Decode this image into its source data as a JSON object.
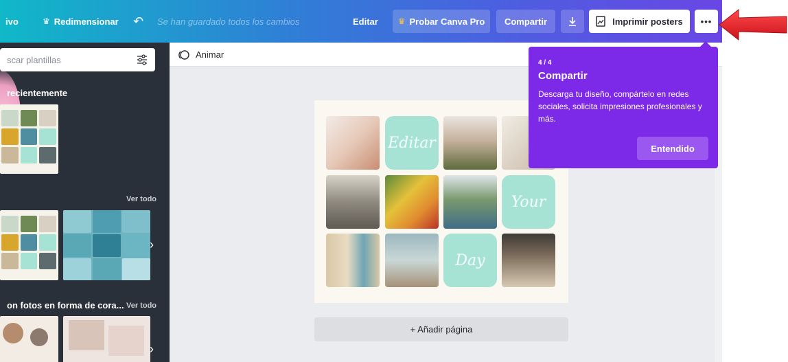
{
  "topbar": {
    "file_partial": "ivo",
    "resize_label": "Redimensionar",
    "saved_status": "Se han guardado todos los cambios",
    "edit_label": "Editar",
    "try_pro_label": "Probar Canva Pro",
    "share_label": "Compartir",
    "print_label": "Imprimir posters",
    "more_label": "•••"
  },
  "sidebar": {
    "search_placeholder": "scar plantillas",
    "recent_heading": "recientemente",
    "section1_link": "Ver todo",
    "section2_heading": "on fotos en forma de cora...",
    "section2_link": "Ver todo"
  },
  "canvas": {
    "animate_label": "Animar",
    "add_page_label": "+ Añadir página",
    "tile_words": [
      "Editar",
      "Your",
      "Day"
    ]
  },
  "tooltip": {
    "step": "4 / 4",
    "title": "Compartir",
    "body": "Descarga tu diseño, compártelo en redes sociales, solicita impresiones profesionales y más.",
    "button_label": "Entendido"
  },
  "colors": {
    "tooltip_bg": "#7d2ae8",
    "sidebar_bg": "#293039",
    "mint_tile": "#a7e3d4",
    "annotation_arrow": "#e8202a"
  }
}
